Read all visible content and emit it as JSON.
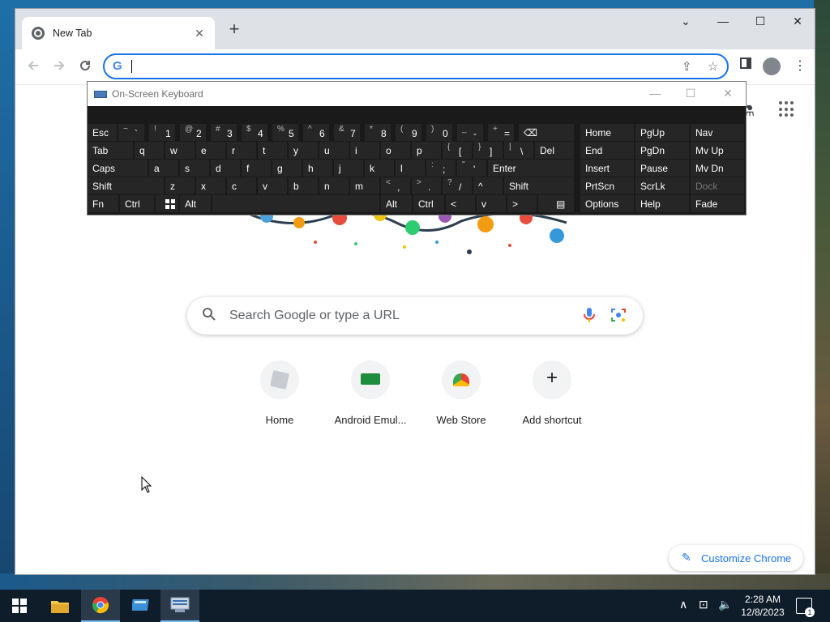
{
  "browser": {
    "tab_title": "New Tab",
    "tab_close": "✕",
    "new_tab": "+",
    "window_controls": {
      "dropdown": "⌄",
      "minimize": "—",
      "maximize": "☐",
      "close": "✕"
    },
    "omnibox_value": "",
    "omnibox_logo": "G"
  },
  "page": {
    "search_placeholder": "Search Google or type a URL",
    "shortcuts": [
      {
        "label": "Home",
        "icon": "home-tile-icon"
      },
      {
        "label": "Android Emul...",
        "icon": "android-emulator-icon"
      },
      {
        "label": "Web Store",
        "icon": "chrome-webstore-icon"
      },
      {
        "label": "Add shortcut",
        "icon": "plus-icon"
      }
    ],
    "add_symbol": "+",
    "customize_label": "Customize Chrome"
  },
  "osk": {
    "title": "On-Screen Keyboard",
    "rows": {
      "r1": [
        "Esc",
        "`",
        "1",
        "2",
        "3",
        "4",
        "5",
        "6",
        "7",
        "8",
        "9",
        "0",
        "-",
        "=",
        "⌫"
      ],
      "r1_shift": [
        "",
        "~",
        "!",
        "@",
        "#",
        "$",
        "%",
        "^",
        "&",
        "*",
        "(",
        ")",
        "_",
        "+",
        ""
      ],
      "r2": [
        "Tab",
        "q",
        "w",
        "e",
        "r",
        "t",
        "y",
        "u",
        "i",
        "o",
        "p",
        "[",
        "]",
        "\\",
        "Del"
      ],
      "r2_shift": [
        "",
        "",
        "",
        "",
        "",
        "",
        "",
        "",
        "",
        "",
        "",
        "{",
        "}",
        "|",
        ""
      ],
      "r3": [
        "Caps",
        "a",
        "s",
        "d",
        "f",
        "g",
        "h",
        "j",
        "k",
        "l",
        ";",
        "'",
        "Enter"
      ],
      "r3_shift": [
        "",
        "",
        "",
        "",
        "",
        "",
        "",
        "",
        "",
        "",
        ":",
        "\"",
        ""
      ],
      "r4": [
        "Shift",
        "z",
        "x",
        "c",
        "v",
        "b",
        "n",
        "m",
        ",",
        ".",
        "/",
        "^",
        "Shift"
      ],
      "r4_shift": [
        "",
        "",
        "",
        "",
        "",
        "",
        "",
        "",
        "<",
        ">",
        "?",
        "",
        ""
      ],
      "r5": [
        "Fn",
        "Ctrl",
        "",
        "Alt",
        "",
        "Alt",
        "Ctrl",
        "<",
        "v",
        ">",
        ""
      ]
    },
    "nav": {
      "c1": [
        "Home",
        "End",
        "Insert",
        "PrtScn",
        "Options"
      ],
      "c2": [
        "PgUp",
        "PgDn",
        "Pause",
        "ScrLk",
        "Help"
      ],
      "c3": [
        "Nav",
        "Mv Up",
        "Mv Dn",
        "Dock",
        "Fade"
      ]
    }
  },
  "taskbar": {
    "clock_time": "2:28 AM",
    "clock_date": "12/8/2023",
    "notification_count": "1"
  }
}
